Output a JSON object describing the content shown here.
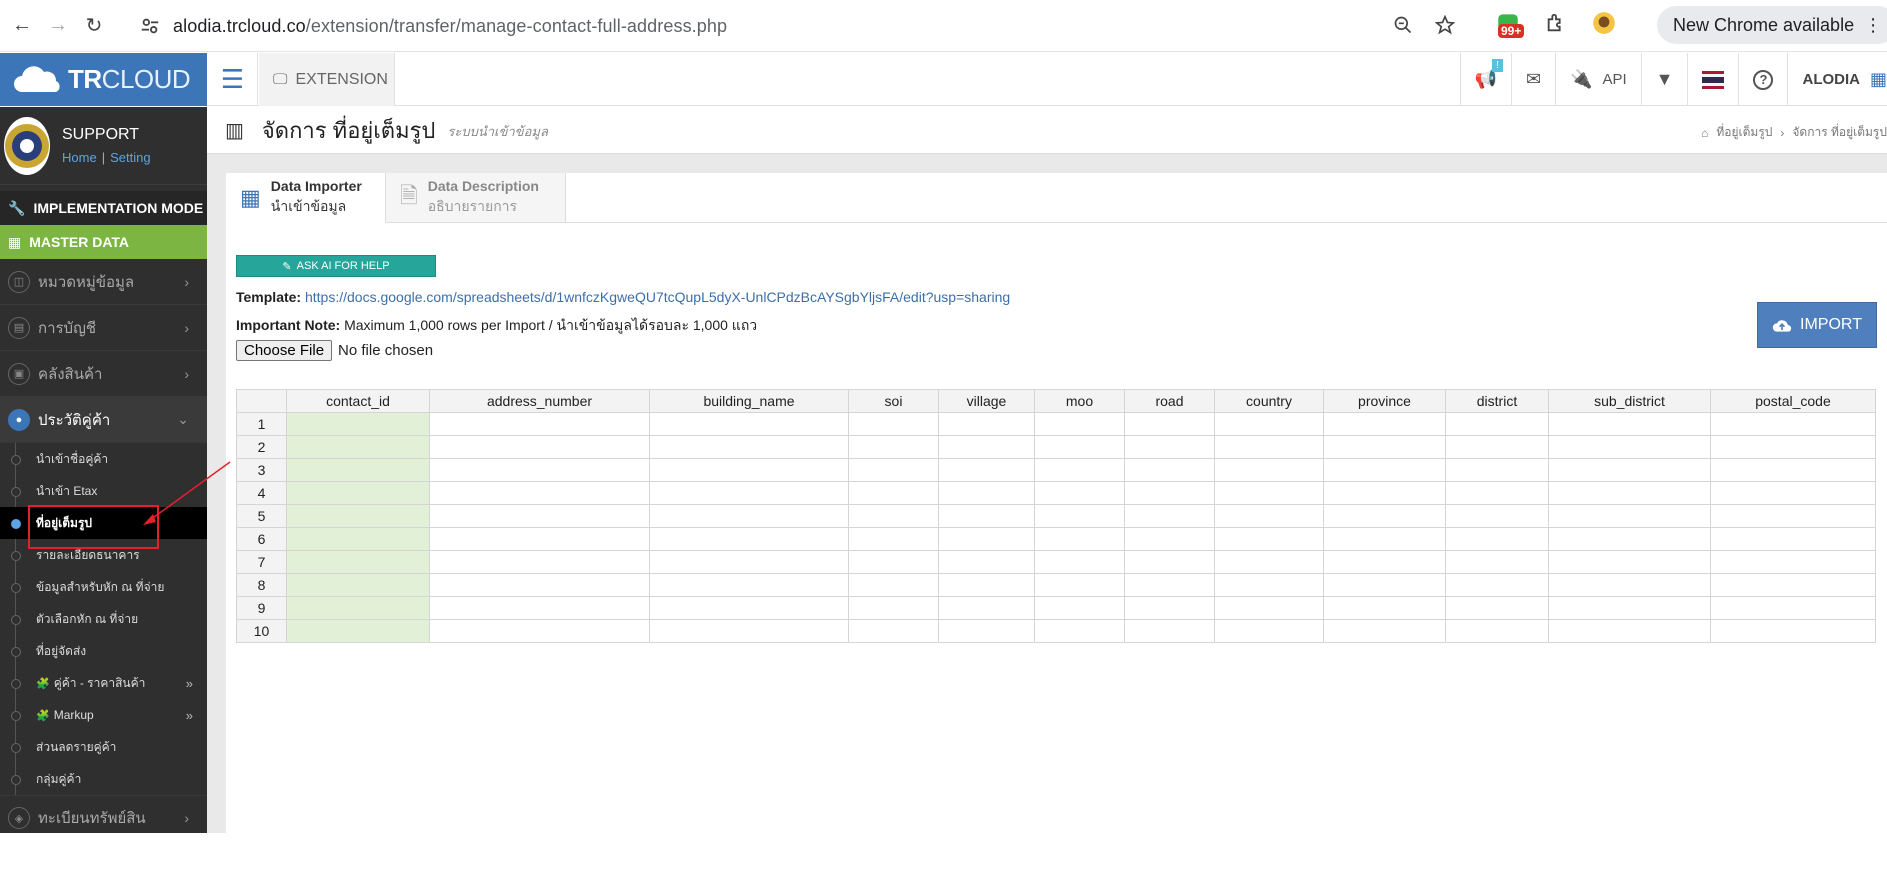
{
  "browser": {
    "url_host": "alodia.trcloud.co",
    "url_path": "/extension/transfer/manage-contact-full-address.php",
    "badge": "99+",
    "update_label": "New Chrome available"
  },
  "header": {
    "logo_bold": "TR",
    "logo_light": "CLOUD",
    "extension_label": "EXTENSION",
    "api_label": "API",
    "user_label": "ALODIA",
    "notice_badge": "!"
  },
  "sidebar": {
    "profile_name": "SUPPORT",
    "home_link": "Home",
    "setting_link": "Setting",
    "implementation_mode": "IMPLEMENTATION MODE",
    "master_data": "MASTER DATA",
    "menu": [
      {
        "label": "หมวดหมู่ข้อมูล"
      },
      {
        "label": "การบัญชี"
      },
      {
        "label": "คลังสินค้า"
      },
      {
        "label": "ประวัติคู่ค้า"
      }
    ],
    "submenu": [
      {
        "label": "นำเข้าชื่อคู่ค้า"
      },
      {
        "label": "นำเข้า Etax"
      },
      {
        "label": "ที่อยู่เต็มรูป"
      },
      {
        "label": "รายละเอียดธนาคาร"
      },
      {
        "label": "ข้อมูลสำหรับหัก ณ ที่จ่าย"
      },
      {
        "label": "ตัวเลือกหัก ณ ที่จ่าย"
      },
      {
        "label": "ที่อยู่จัดส่ง"
      },
      {
        "label": "คู่ค้า - ราคาสินค้า"
      },
      {
        "label": "Markup"
      },
      {
        "label": "ส่วนลดรายคู่ค้า"
      },
      {
        "label": "กลุ่มคู่ค้า"
      }
    ],
    "bottom_menu": "ทะเบียนทรัพย์สิน"
  },
  "page": {
    "title": "จัดการ ที่อยู่เต็มรูป",
    "subtitle": "ระบบนำเข้าข้อมูล",
    "breadcrumb": [
      "ที่อยู่เต็มรูป",
      "จัดการ ที่อยู่เต็มรูป"
    ]
  },
  "tabs": [
    {
      "title": "Data Importer",
      "subtitle": "นำเข้าข้อมูล"
    },
    {
      "title": "Data Description",
      "subtitle": "อธิบายรายการ"
    }
  ],
  "importer": {
    "ai_button": "ASK AI FOR HELP",
    "template_label": "Template:",
    "template_url": "https://docs.google.com/spreadsheets/d/1wnfczKgweQU7tcQupL5dyX-UnlCPdzBcAYSgbYljsFA/edit?usp=sharing",
    "note_label": "Important Note:",
    "note_text": "Maximum 1,000 rows per Import / นำเข้าข้อมูลได้รอบละ 1,000 แถว",
    "choose_file": "Choose File",
    "no_file": "No file chosen",
    "import_button": "IMPORT"
  },
  "grid": {
    "columns": [
      "contact_id",
      "address_number",
      "building_name",
      "soi",
      "village",
      "moo",
      "road",
      "country",
      "province",
      "district",
      "sub_district",
      "postal_code"
    ],
    "rows": [
      "1",
      "2",
      "3",
      "4",
      "5",
      "6",
      "7",
      "8",
      "9",
      "10"
    ]
  }
}
